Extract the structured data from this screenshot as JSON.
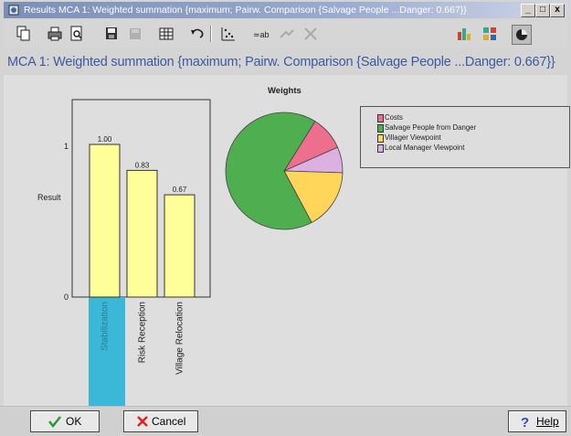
{
  "window": {
    "title": "Results MCA 1: Weighted summation {maximum; Pairw. Comparison {Salvage People ...Danger: 0.667}}",
    "controls": [
      "_",
      "□",
      "x"
    ]
  },
  "toolbar": {
    "left_icons": [
      "copy-icon",
      "print-icon",
      "print-preview-icon",
      "save-icon",
      "disabled-save-icon",
      "table-icon",
      "undo-icon",
      "scatter-icon",
      "link-icon",
      "disabled-tool-icon",
      "cancel-icon"
    ],
    "right_icons": [
      "bar-chart-icon",
      "grid-chart-icon",
      "pie-chart-icon"
    ]
  },
  "heading": "MCA 1: Weighted summation {maximum; Pairw. Comparison {Salvage People ...Danger: 0.667}}",
  "bar_chart": {
    "ylabel": "Result",
    "y_ticks": [
      "1",
      "0"
    ],
    "selected_category": "Stabilization"
  },
  "pie_chart": {
    "title": "Weights"
  },
  "chart_data": [
    {
      "type": "bar",
      "ylabel": "Result",
      "categories": [
        "Stabilization",
        "Risk Reception",
        "Village Relocation"
      ],
      "values": [
        1.0,
        0.83,
        0.67
      ],
      "value_labels": [
        "1.00",
        "0.83",
        "0.67"
      ],
      "ylim": [
        0,
        1
      ],
      "color": "#ffff99"
    },
    {
      "type": "pie",
      "title": "Weights",
      "categories": [
        "Costs",
        "Salvage People from Danger",
        "Villager Viewpoint",
        "Local Manager Viewpoint"
      ],
      "values": [
        0.095,
        0.667,
        0.167,
        0.071
      ],
      "colors": [
        "#ee6e8e",
        "#4fae4f",
        "#ffd65a",
        "#dcb0e0"
      ]
    }
  ],
  "legend": {
    "items": [
      "Costs",
      "Salvage People from Danger",
      "Villager Viewpoint",
      "Local Manager Viewpoint"
    ]
  },
  "buttons": {
    "ok": "OK",
    "cancel": "Cancel",
    "help": "Help"
  }
}
